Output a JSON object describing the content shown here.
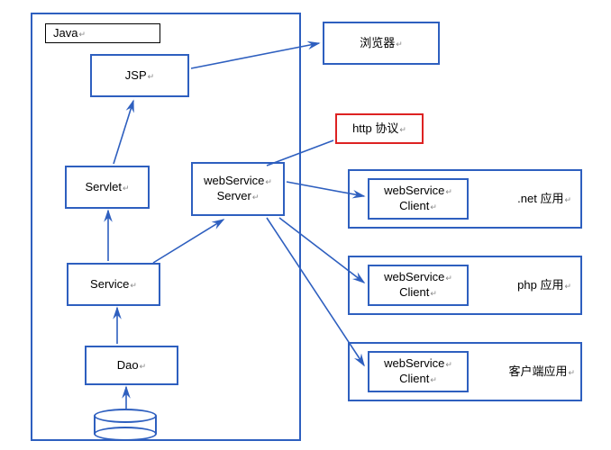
{
  "java_container": {
    "label": "Java"
  },
  "jsp": {
    "label": "JSP"
  },
  "servlet": {
    "label": "Servlet"
  },
  "service": {
    "label": "Service"
  },
  "dao": {
    "label": "Dao"
  },
  "ws_server": {
    "line1": "webService",
    "line2": "Server"
  },
  "browser": {
    "label": "浏览器"
  },
  "http": {
    "label": "http 协议"
  },
  "client_net": {
    "line1": "webService",
    "line2": "Client",
    "app_label": ".net 应用"
  },
  "client_php": {
    "line1": "webService",
    "line2": "Client",
    "app_label": "php 应用"
  },
  "client_other": {
    "line1": "webService",
    "line2": "Client",
    "app_label": "客户端应用"
  },
  "colors": {
    "line": "#2e5fbf"
  }
}
